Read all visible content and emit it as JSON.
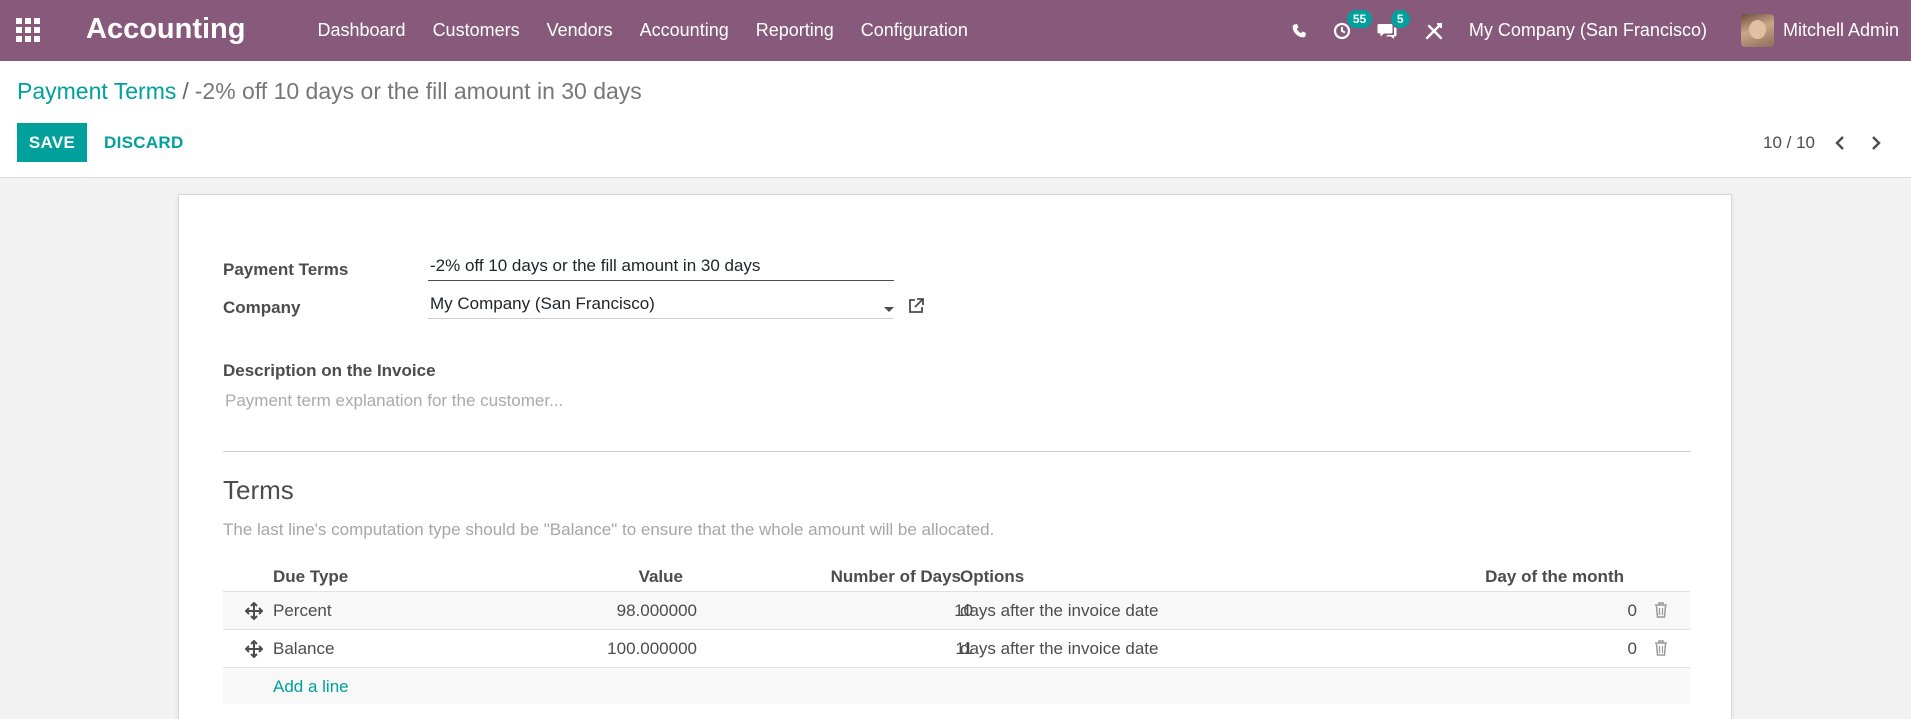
{
  "navbar": {
    "app_title": "Accounting",
    "menu": [
      "Dashboard",
      "Customers",
      "Vendors",
      "Accounting",
      "Reporting",
      "Configuration"
    ],
    "activity_count": "55",
    "messages_count": "5",
    "company": "My Company (San Francisco)",
    "user": "Mitchell Admin",
    "icons": [
      "apps-grid-icon",
      "phone-icon",
      "clock-activity-icon",
      "chat-icon",
      "debug-tools-icon"
    ]
  },
  "control_panel": {
    "breadcrumb_parent": "Payment Terms",
    "breadcrumb_separator": "/",
    "breadcrumb_current": "-2% off 10 days or the fill amount in 30 days",
    "save_label": "SAVE",
    "discard_label": "DISCARD",
    "pager": "10 / 10"
  },
  "form": {
    "payment_terms_label": "Payment Terms",
    "payment_terms_value": "-2% off 10 days or the fill amount in 30 days",
    "company_label": "Company",
    "company_value": "My Company (San Francisco)",
    "description_label": "Description on the Invoice",
    "description_placeholder": "Payment term explanation for the customer..."
  },
  "terms": {
    "title": "Terms",
    "help": "The last line's computation type should be \"Balance\" to ensure that the whole amount will be allocated.",
    "columns": {
      "due_type": "Due Type",
      "value": "Value",
      "days": "Number of Days",
      "options": "Options",
      "day_of_month": "Day of the month"
    },
    "rows": [
      {
        "due_type": "Percent",
        "value": "98.000000",
        "days": "10",
        "options": "days after the invoice date",
        "day_of_month": "0"
      },
      {
        "due_type": "Balance",
        "value": "100.000000",
        "days": "11",
        "options": "days after the invoice date",
        "day_of_month": "0"
      }
    ],
    "add_line": "Add a line"
  },
  "colors": {
    "navbar": "#875a7b",
    "accent": "#00a09d"
  }
}
